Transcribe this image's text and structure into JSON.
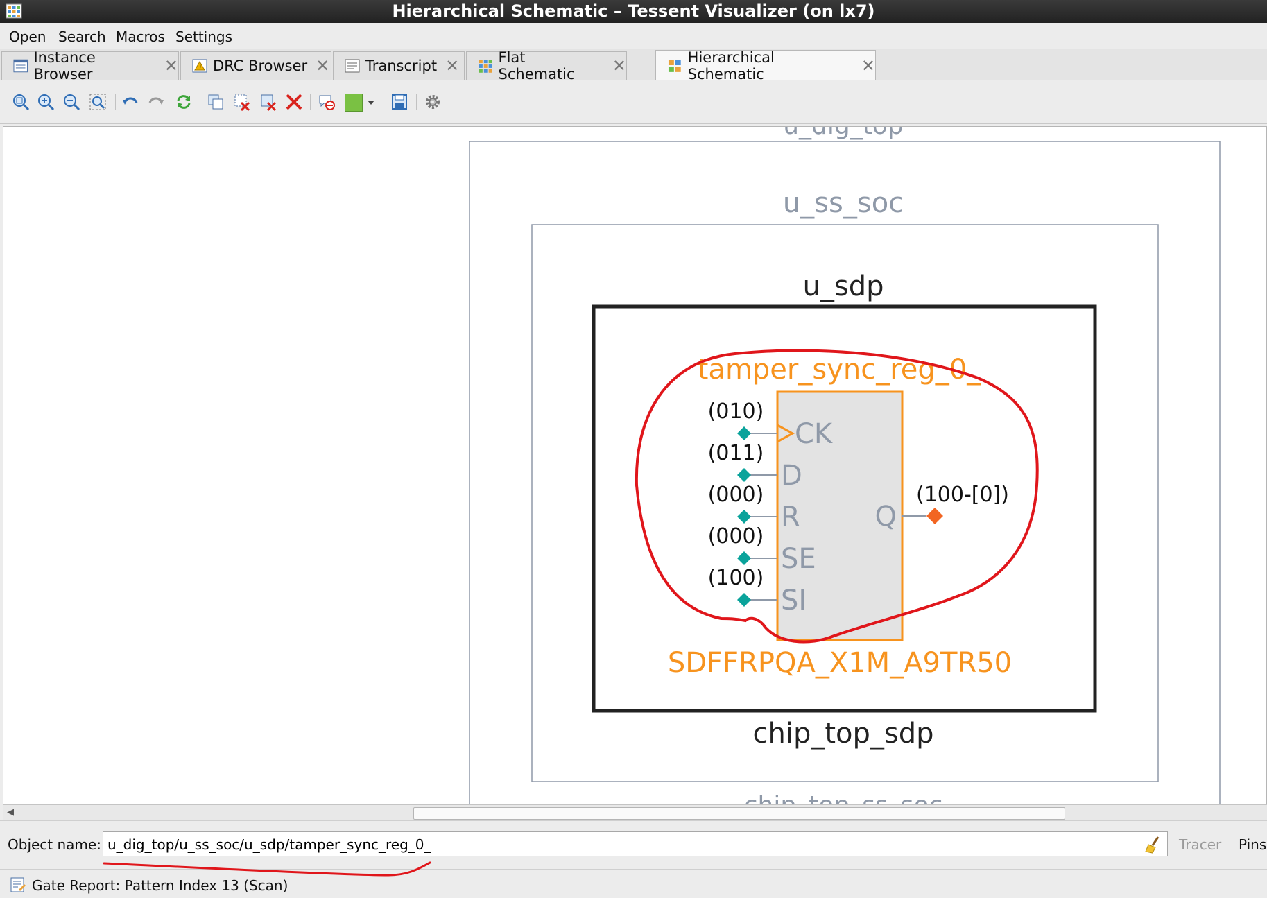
{
  "window": {
    "title": "Hierarchical Schematic – Tessent Visualizer (on lx7)"
  },
  "menu": {
    "items": [
      "Open",
      "Search",
      "Macros",
      "Settings"
    ]
  },
  "tabs": [
    {
      "label": "Instance Browser",
      "icon": "instance-browser-icon"
    },
    {
      "label": "DRC Browser",
      "icon": "drc-browser-icon"
    },
    {
      "label": "Transcript",
      "icon": "transcript-icon"
    },
    {
      "label": "Flat Schematic",
      "icon": "flat-schematic-icon"
    },
    {
      "label": "Hierarchical Schematic",
      "icon": "hierarchical-schematic-icon",
      "active": true
    }
  ],
  "toolbar": {
    "icons": [
      "zoom-fit-icon",
      "zoom-in-icon",
      "zoom-out-icon",
      "zoom-area-icon",
      "undo-icon",
      "redo-icon",
      "refresh-icon",
      "copy-icon",
      "delete-selected-icon",
      "delete-others-icon",
      "delete-all-icon",
      "highlight-icon",
      "color-swatch-icon",
      "dropdown-arrow-icon",
      "save-view-icon",
      "settings-icon"
    ],
    "swatch_color": "#7ac143"
  },
  "schematic": {
    "hierarchy_top_label": "u_dig_top",
    "outer_label": "u_ss_soc",
    "inner_label": "u_sdp",
    "inner_module": "chip_top_sdp",
    "outer_module_bottom": "chip_top_ss_soc",
    "cell": {
      "instance_name": "tamper_sync_reg_0_",
      "cell_type": "SDFFRPQA_X1M_A9TR50",
      "input_pins": [
        {
          "name": "CK",
          "value": "(010)"
        },
        {
          "name": "D",
          "value": "(011)"
        },
        {
          "name": "R",
          "value": "(000)"
        },
        {
          "name": "SE",
          "value": "(000)"
        },
        {
          "name": "SI",
          "value": "(100)"
        }
      ],
      "output_pin": {
        "name": "Q",
        "value": "(100-[0])"
      }
    },
    "colors": {
      "cell_highlight": "#f7931e",
      "input_pin": "#0aa39b",
      "output_pin": "#f26522",
      "hierarchy_border": "#8f99a8",
      "annotation": "#e0161b"
    }
  },
  "object_name": {
    "label": "Object name:",
    "value": "u_dig_top/u_ss_soc/u_sdp/tamper_sync_reg_0_"
  },
  "tracer_label": "Tracer",
  "pins_label": "Pins",
  "status": {
    "text": "Gate Report: Pattern Index 13 (Scan)"
  }
}
